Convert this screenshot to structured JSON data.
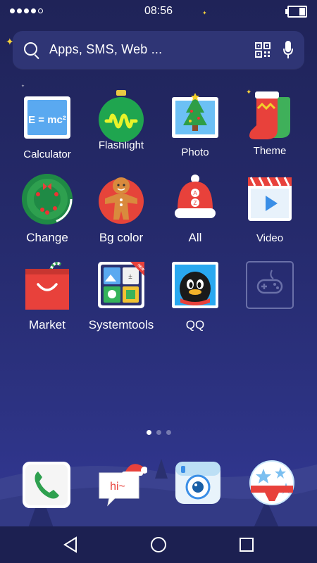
{
  "status": {
    "time": "08:56"
  },
  "search": {
    "placeholder": "Apps, SMS, Web ..."
  },
  "calc_formula": "E = mc²",
  "apps": [
    {
      "label": "Calculator"
    },
    {
      "label": "Flashlight"
    },
    {
      "label": "Photo"
    },
    {
      "label": "Theme"
    },
    {
      "label": "Change"
    },
    {
      "label": "Bg color"
    },
    {
      "label": "All"
    },
    {
      "label": "Video"
    },
    {
      "label": "Market"
    },
    {
      "label": "Systemtools"
    },
    {
      "label": "QQ"
    },
    {
      "label": ""
    }
  ],
  "hat_letters": "A\nZ",
  "new_badge": "NEW",
  "sms_text": "hi~",
  "page_indicator": {
    "current": 1,
    "total": 3
  },
  "colors": {
    "background": "#252a6b",
    "accent_star": "#f6d23c"
  },
  "icons": [
    "phone-icon",
    "messaging-icon",
    "camera-icon",
    "browser-icon"
  ]
}
